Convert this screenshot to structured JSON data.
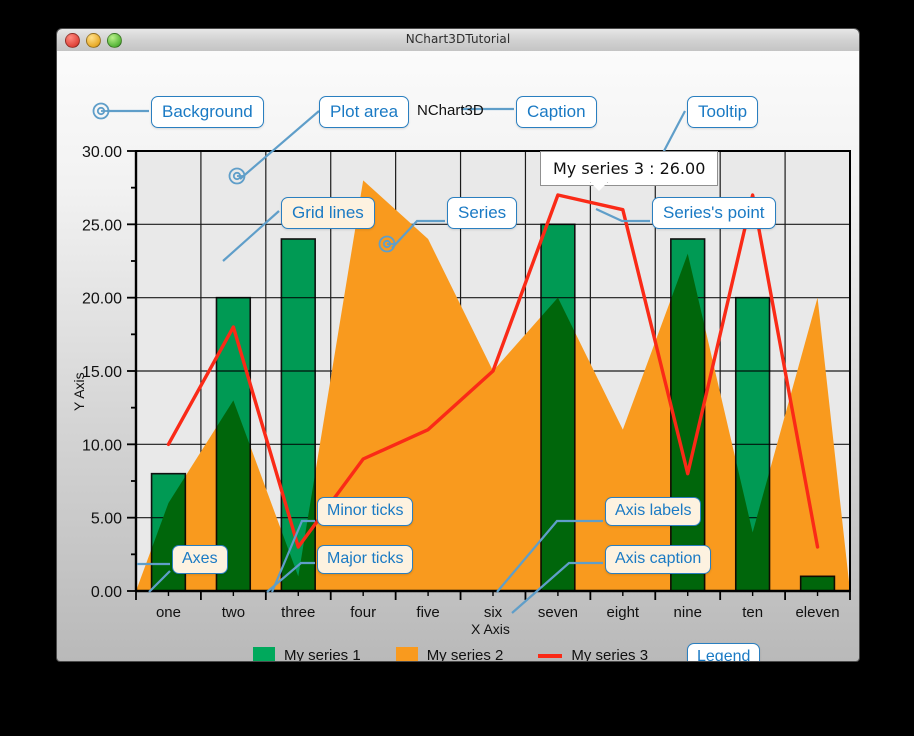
{
  "window": {
    "title": "NChart3DTutorial",
    "buttons": {
      "close": "close",
      "minimize": "minimize",
      "zoom": "zoom"
    }
  },
  "caption": {
    "text": "NChart3D"
  },
  "tooltip": {
    "text": "My series 3 : 26.00"
  },
  "axes": {
    "x": {
      "caption": "X Axis"
    },
    "y": {
      "caption": "Y Axis"
    }
  },
  "callouts": [
    {
      "id": "background",
      "label": "Background"
    },
    {
      "id": "plot-area",
      "label": "Plot area"
    },
    {
      "id": "caption",
      "label": "Caption"
    },
    {
      "id": "tooltip",
      "label": "Tooltip"
    },
    {
      "id": "grid-lines",
      "label": "Grid lines"
    },
    {
      "id": "series",
      "label": "Series"
    },
    {
      "id": "series-point",
      "label": "Series's point"
    },
    {
      "id": "minor-ticks",
      "label": "Minor ticks"
    },
    {
      "id": "major-ticks",
      "label": "Major ticks"
    },
    {
      "id": "axis-labels",
      "label": "Axis labels"
    },
    {
      "id": "axes",
      "label": "Axes"
    },
    {
      "id": "axis-caption",
      "label": "Axis caption"
    },
    {
      "id": "legend",
      "label": "Legend"
    }
  ],
  "colors": {
    "series1": "#00A95C",
    "series2": "#F99A1E",
    "series3": "#FA2A17",
    "callout_border": "#2a7fc0",
    "callout_text": "#1a7ac4",
    "callout_fill_white": "#ffffff",
    "callout_fill_cream": "#fdf2e0",
    "leader_line": "#5f9ec9",
    "plot_bg": "#e9e9e9",
    "grid": "#1b1b1b",
    "axis": "#000000"
  },
  "chart_data": {
    "type": "bar",
    "title": "NChart3D",
    "xlabel": "X Axis",
    "ylabel": "Y Axis",
    "ylim": [
      0,
      30
    ],
    "yticks": [
      0,
      5,
      10,
      15,
      20,
      25,
      30
    ],
    "ytick_labels": [
      "0.00",
      "5.00",
      "10.00",
      "15.00",
      "20.00",
      "25.00",
      "30.00"
    ],
    "minor_tick_step": 2.5,
    "grid": true,
    "legend_position": "bottom",
    "categories": [
      "one",
      "two",
      "three",
      "four",
      "five",
      "six",
      "seven",
      "eight",
      "nine",
      "ten",
      "eleven"
    ],
    "series": [
      {
        "name": "My series 1",
        "type": "bar",
        "color": "#00A95C",
        "values": [
          8,
          20,
          24,
          0,
          0,
          0,
          25,
          0,
          24,
          20,
          1
        ]
      },
      {
        "name": "My series 2",
        "type": "area",
        "color": "#F99A1E",
        "values": [
          6,
          13,
          1,
          28,
          24,
          15,
          20,
          11,
          23,
          4,
          20
        ]
      },
      {
        "name": "My series 3",
        "type": "line",
        "color": "#FA2A17",
        "values": [
          10,
          18,
          3,
          9,
          11,
          15,
          27,
          26,
          8,
          27,
          3
        ]
      }
    ],
    "legend": [
      {
        "name": "My series 1",
        "color": "#00A95C",
        "marker": "square"
      },
      {
        "name": "My series 2",
        "color": "#F99A1E",
        "marker": "square"
      },
      {
        "name": "My series 3",
        "color": "#FA2A17",
        "marker": "line"
      }
    ],
    "annotation": {
      "series": "My series 3",
      "category": "eight",
      "value": 26,
      "text": "My series 3 : 26.00"
    }
  }
}
